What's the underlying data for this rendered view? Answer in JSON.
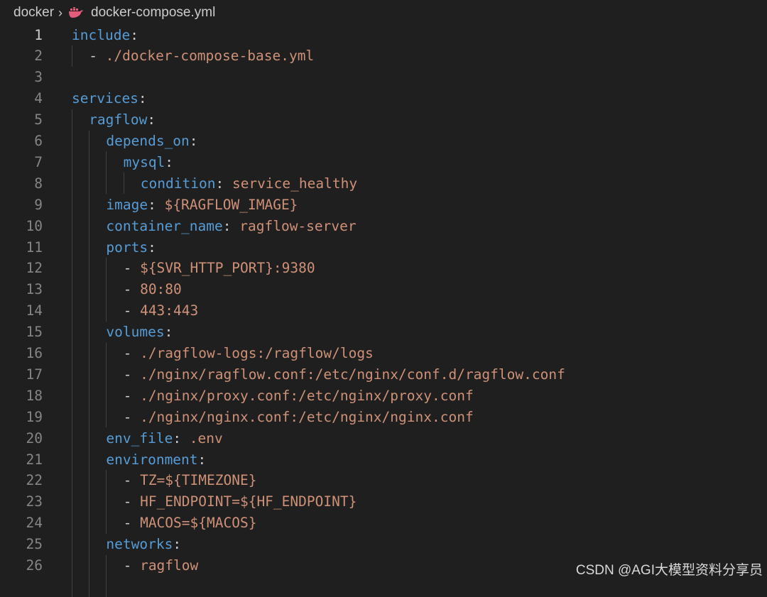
{
  "breadcrumb": {
    "folder": "docker",
    "separator": "›",
    "file": "docker-compose.yml",
    "file_icon": "docker-whale-icon"
  },
  "colors": {
    "background": "#1f1f1f",
    "key": "#569cd6",
    "string": "#ce9178",
    "punctuation": "#cccccc",
    "line_number": "#858585",
    "line_number_active": "#cccccc"
  },
  "editor": {
    "active_line": 1,
    "lines": [
      {
        "n": "1",
        "indent": 0,
        "key": "include",
        "sep": ":",
        "val": ""
      },
      {
        "n": "2",
        "indent": 1,
        "dash": "- ",
        "key": "",
        "sep": "",
        "val": "./docker-compose-base.yml"
      },
      {
        "n": "3",
        "indent": 0,
        "key": "",
        "sep": "",
        "val": ""
      },
      {
        "n": "4",
        "indent": 0,
        "key": "services",
        "sep": ":",
        "val": ""
      },
      {
        "n": "5",
        "indent": 1,
        "key": "ragflow",
        "sep": ":",
        "val": ""
      },
      {
        "n": "6",
        "indent": 2,
        "key": "depends_on",
        "sep": ":",
        "val": ""
      },
      {
        "n": "7",
        "indent": 3,
        "key": "mysql",
        "sep": ":",
        "val": ""
      },
      {
        "n": "8",
        "indent": 4,
        "key": "condition",
        "sep": ": ",
        "val": "service_healthy"
      },
      {
        "n": "9",
        "indent": 2,
        "key": "image",
        "sep": ": ",
        "val": "${RAGFLOW_IMAGE}"
      },
      {
        "n": "10",
        "indent": 2,
        "key": "container_name",
        "sep": ": ",
        "val": "ragflow-server"
      },
      {
        "n": "11",
        "indent": 2,
        "key": "ports",
        "sep": ":",
        "val": ""
      },
      {
        "n": "12",
        "indent": 3,
        "dash": "- ",
        "key": "",
        "sep": "",
        "val": "${SVR_HTTP_PORT}:9380"
      },
      {
        "n": "13",
        "indent": 3,
        "dash": "- ",
        "key": "",
        "sep": "",
        "val": "80:80"
      },
      {
        "n": "14",
        "indent": 3,
        "dash": "- ",
        "key": "",
        "sep": "",
        "val": "443:443"
      },
      {
        "n": "15",
        "indent": 2,
        "key": "volumes",
        "sep": ":",
        "val": ""
      },
      {
        "n": "16",
        "indent": 3,
        "dash": "- ",
        "key": "",
        "sep": "",
        "val": "./ragflow-logs:/ragflow/logs"
      },
      {
        "n": "17",
        "indent": 3,
        "dash": "- ",
        "key": "",
        "sep": "",
        "val": "./nginx/ragflow.conf:/etc/nginx/conf.d/ragflow.conf"
      },
      {
        "n": "18",
        "indent": 3,
        "dash": "- ",
        "key": "",
        "sep": "",
        "val": "./nginx/proxy.conf:/etc/nginx/proxy.conf"
      },
      {
        "n": "19",
        "indent": 3,
        "dash": "- ",
        "key": "",
        "sep": "",
        "val": "./nginx/nginx.conf:/etc/nginx/nginx.conf"
      },
      {
        "n": "20",
        "indent": 2,
        "key": "env_file",
        "sep": ": ",
        "val": ".env"
      },
      {
        "n": "21",
        "indent": 2,
        "key": "environment",
        "sep": ":",
        "val": ""
      },
      {
        "n": "22",
        "indent": 3,
        "dash": "- ",
        "key": "",
        "sep": "",
        "val": "TZ=${TIMEZONE}"
      },
      {
        "n": "23",
        "indent": 3,
        "dash": "- ",
        "key": "",
        "sep": "",
        "val": "HF_ENDPOINT=${HF_ENDPOINT}"
      },
      {
        "n": "24",
        "indent": 3,
        "dash": "- ",
        "key": "",
        "sep": "",
        "val": "MACOS=${MACOS}"
      },
      {
        "n": "25",
        "indent": 2,
        "key": "networks",
        "sep": ":",
        "val": ""
      },
      {
        "n": "26",
        "indent": 3,
        "dash": "- ",
        "key": "",
        "sep": "",
        "val": "ragflow"
      }
    ]
  },
  "watermark": "CSDN @AGI大模型资料分享员"
}
